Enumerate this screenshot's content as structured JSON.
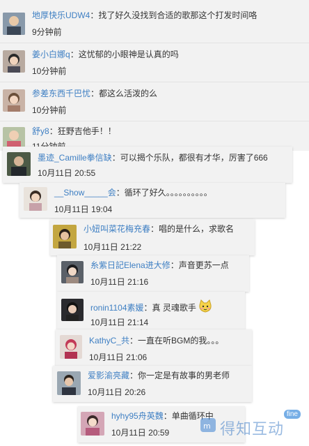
{
  "comments": [
    {
      "name": "地厚快乐UDW4",
      "text": "找了好久没找到合适的歌那这个打发时间咯",
      "time": "9分钟前"
    },
    {
      "name": "姜小白娜q",
      "text": "这忧郁的小眼神是认真的吗",
      "time": "10分钟前"
    },
    {
      "name": "参差东西千巴忧",
      "text": "都这么活泼的么",
      "time": "10分钟前"
    },
    {
      "name": "舒y8",
      "text": "狂野吉他手！！",
      "time": "11分钟前"
    }
  ],
  "replies": [
    {
      "name": "墨迹_Camille拳信缺",
      "text": "可以揭个乐队，都很有才华，厉害了666",
      "time": "10月11日 20:55"
    },
    {
      "name": "__Show_____会",
      "text": "循环了好久。。。。。。。。。。",
      "time": "10月11日 19:04"
    },
    {
      "name": "小妞叫菜花梅充春",
      "text": "唱的是什么，求歌名",
      "time": "10月11日 21:22"
    },
    {
      "name": "糸紫日記Elena进大修",
      "text": "声音更苏一点",
      "time": "10月11日 21:16"
    },
    {
      "name": "ronin1104素媛",
      "text": "真 灵魂歌手",
      "time": "10月11日 21:14"
    },
    {
      "name": "KathyC_共",
      "text": "一直在听BGM的我。。。",
      "time": "10月11日 21:06"
    },
    {
      "name": "爱影渝亮藏",
      "text": "你一定是有故事的男老师",
      "time": "10月11日 20:26"
    },
    {
      "name": "hyhy95舟英魏",
      "text": "单曲循环中",
      "time": "10月11日 20:59"
    }
  ],
  "colon": "：",
  "watermark": {
    "text": "得知互动",
    "badge": "fine"
  },
  "colors": {
    "name": "#3e7fc3",
    "card": "#f2f2f2",
    "text": "#333333"
  }
}
